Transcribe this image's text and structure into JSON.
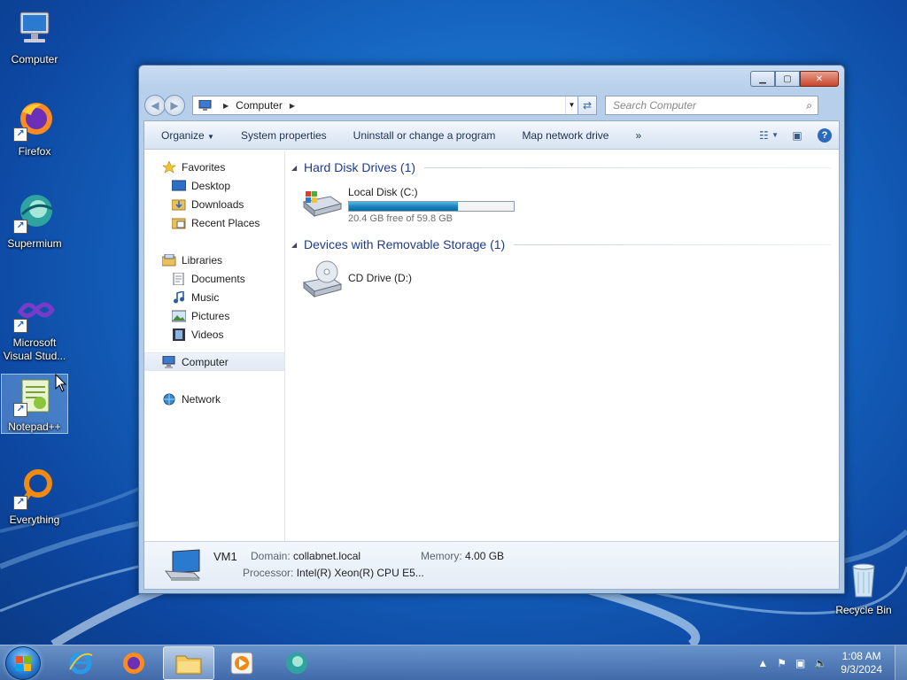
{
  "desktop": {
    "icons": [
      {
        "label": "Computer"
      },
      {
        "label": "Firefox"
      },
      {
        "label": "Supermium"
      },
      {
        "label": "Microsoft Visual Stud..."
      },
      {
        "label": "Notepad++"
      },
      {
        "label": "Everything"
      },
      {
        "label": "Recycle Bin"
      }
    ]
  },
  "window": {
    "address": {
      "location": "Computer"
    },
    "search": {
      "placeholder": "Search Computer"
    },
    "toolbar": {
      "organize": "Organize",
      "system_properties": "System properties",
      "uninstall": "Uninstall or change a program",
      "map_drive": "Map network drive",
      "more": "»"
    },
    "nav": {
      "favorites": "Favorites",
      "desktop": "Desktop",
      "downloads": "Downloads",
      "recent": "Recent Places",
      "libraries": "Libraries",
      "documents": "Documents",
      "music": "Music",
      "pictures": "Pictures",
      "videos": "Videos",
      "computer": "Computer",
      "network": "Network"
    },
    "groups": {
      "hdd": "Hard Disk Drives (1)",
      "removable": "Devices with Removable Storage (1)"
    },
    "drives": {
      "c": {
        "name": "Local Disk (C:)",
        "free_text": "20.4 GB free of 59.8 GB",
        "used_fraction": 0.66
      },
      "d": {
        "name": "CD Drive (D:)"
      }
    },
    "details": {
      "name": "VM1",
      "domain_label": "Domain:",
      "domain_value": "collabnet.local",
      "memory_label": "Memory:",
      "memory_value": "4.00 GB",
      "processor_label": "Processor:",
      "processor_value": "Intel(R) Xeon(R) CPU E5..."
    }
  },
  "taskbar": {
    "clock_time": "1:08 AM",
    "clock_date": "9/3/2024"
  }
}
